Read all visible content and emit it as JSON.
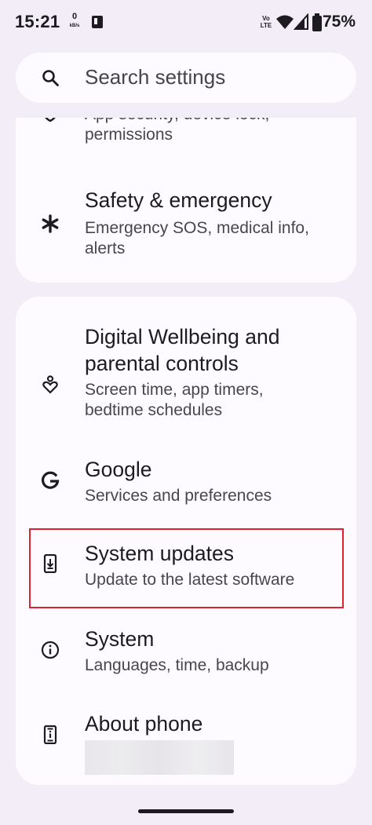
{
  "status_bar": {
    "time": "15:21",
    "net_speed_value": "0",
    "net_speed_unit": "kB/s",
    "volte_line1": "Vo",
    "volte_line2": "LTE",
    "battery_percent": "75%",
    "icons": [
      "notification-app-icon",
      "wifi-icon",
      "signal-icon",
      "battery-icon"
    ]
  },
  "search": {
    "placeholder": "Search settings",
    "icon": "search-icon"
  },
  "settings_top_card": [
    {
      "icon": "shield-lock-icon",
      "title": "",
      "subtitle": "App security, device lock,\npermissions"
    },
    {
      "icon": "asterisk-medical-icon",
      "title": "Safety & emergency",
      "subtitle": "Emergency SOS, medical info,\nalerts"
    }
  ],
  "settings_bottom_card": [
    {
      "icon": "wellbeing-icon",
      "title": "Digital Wellbeing and\nparental controls",
      "subtitle": "Screen time, app timers,\nbedtime schedules"
    },
    {
      "icon": "google-g-icon",
      "title": "Google",
      "subtitle": "Services and preferences"
    },
    {
      "icon": "system-update-icon",
      "title": "System updates",
      "subtitle": "Update to the latest software"
    },
    {
      "icon": "info-icon",
      "title": "System",
      "subtitle": "Languages, time, backup"
    },
    {
      "icon": "phone-info-icon",
      "title": "About phone",
      "subtitle": ""
    }
  ],
  "colors": {
    "background": "#f3edf7",
    "card": "#fdfbff",
    "highlight": "#e0202f"
  }
}
